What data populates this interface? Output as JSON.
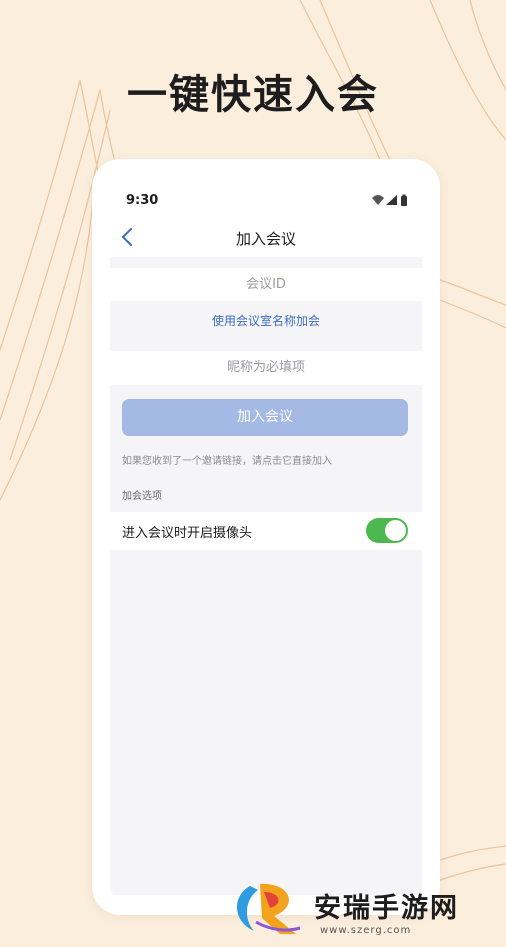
{
  "headline": "一键快速入会",
  "status_bar": {
    "time": "9:30"
  },
  "nav": {
    "title": "加入会议"
  },
  "form": {
    "meeting_id_placeholder": "会议ID",
    "use_room_name_link": "使用会议室名称加会",
    "nickname_placeholder": "昵称为必填项",
    "join_button": "加入会议",
    "invite_hint": "如果您收到了一个邀请链接，请点击它直接加入"
  },
  "options": {
    "section_label": "加会选项",
    "camera_label": "进入会议时开启摄像头",
    "camera_enabled": true
  },
  "colors": {
    "background": "#fbeedd",
    "accent_link": "#3e6cc0",
    "button_disabled": "#a4b9e3",
    "toggle_on": "#4cb84f"
  },
  "icons": [
    "back-arrow-icon",
    "wifi-icon",
    "cell-signal-icon",
    "battery-icon"
  ],
  "watermark": {
    "title": "安瑞手游网",
    "url": "www.szerg.com"
  }
}
